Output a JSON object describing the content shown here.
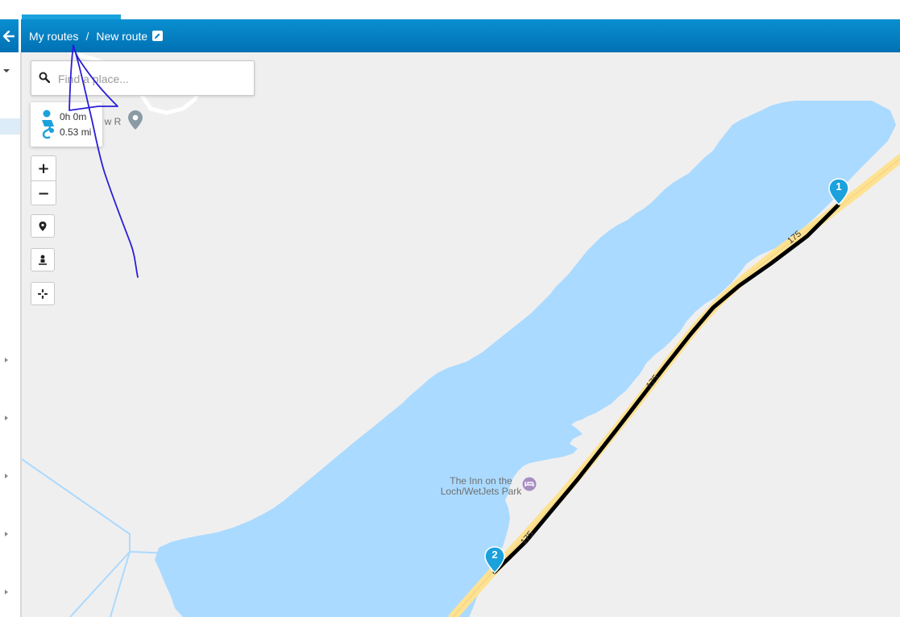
{
  "header": {
    "back_icon": "arrow-left-icon",
    "breadcrumb": {
      "parent": "My routes",
      "separator": "/",
      "current": "New route",
      "edit_icon": "pencil-icon"
    }
  },
  "search": {
    "placeholder": "Find a place...",
    "icon": "search-icon"
  },
  "route_stats": {
    "duration": "0h 0m",
    "distance": "0.53 mi"
  },
  "map_controls": {
    "zoom_in": "+",
    "zoom_out": "−",
    "buttons": [
      "pin-icon",
      "person-icon",
      "crosshair-icon"
    ]
  },
  "map": {
    "poi_label_line1": "The Inn on the",
    "poi_label_line2": "Loch/WetJets Park",
    "road_shields": [
      "175",
      "175",
      "175"
    ],
    "place_fragment": "t w R",
    "markers": [
      "1",
      "2"
    ],
    "colors": {
      "water": "#aadaff",
      "land": "#f0efef",
      "road": "#fde293",
      "route": "#000000",
      "marker": "#1ba1dc"
    }
  }
}
